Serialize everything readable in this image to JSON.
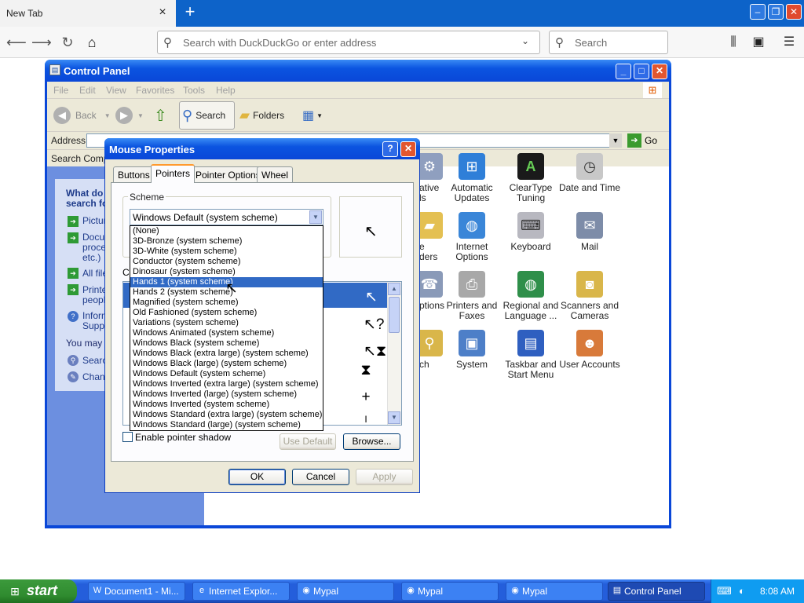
{
  "browser": {
    "tab_title": "New Tab",
    "url_placeholder": "Search with DuckDuckGo or enter address",
    "search_placeholder": "Search"
  },
  "control_panel": {
    "title": "Control Panel",
    "menu": [
      "File",
      "Edit",
      "View",
      "Favorites",
      "Tools",
      "Help"
    ],
    "toolbar": {
      "back": "Back",
      "search": "Search",
      "folders": "Folders"
    },
    "address_label": "Address",
    "go_label": "Go",
    "search_companion": "Search Compa",
    "task_header": "What do search fo",
    "tasks": [
      {
        "label": "Pictur"
      },
      {
        "label": "Docur\nproce\netc.)"
      },
      {
        "label": "All file"
      },
      {
        "label": "Printe\npeopl"
      },
      {
        "label": "Inform\nSuppo"
      }
    ],
    "may_also": "You may a",
    "extra_tasks": [
      "Search",
      "Chanc"
    ],
    "items": [
      {
        "label": "ative\nls"
      },
      {
        "label": "Automatic\nUpdates"
      },
      {
        "label": "ClearType\nTuning"
      },
      {
        "label": "Date and Time"
      },
      {
        "label": "e\nders"
      },
      {
        "label": "Internet\nOptions"
      },
      {
        "label": "Keyboard"
      },
      {
        "label": "Mail"
      },
      {
        "label": "ptions"
      },
      {
        "label": "Printers and\nFaxes"
      },
      {
        "label": "Regional and\nLanguage ..."
      },
      {
        "label": "Scanners and\nCameras"
      },
      {
        "label": "ch"
      },
      {
        "label": "System"
      },
      {
        "label": "Taskbar and\nStart Menu"
      },
      {
        "label": "User Accounts"
      }
    ]
  },
  "mouse_props": {
    "title": "Mouse Properties",
    "tabs": [
      "Buttons",
      "Pointers",
      "Pointer Options",
      "Wheel"
    ],
    "scheme_label": "Scheme",
    "scheme_value": "Windows Default (system scheme)",
    "customize_label": "C",
    "scheme_options": [
      "(None)",
      "3D-Bronze (system scheme)",
      "3D-White (system scheme)",
      "Conductor (system scheme)",
      "Dinosaur (system scheme)",
      "Hands 1 (system scheme)",
      "Hands 2 (system scheme)",
      "Magnified (system scheme)",
      "Old Fashioned (system scheme)",
      "Variations (system scheme)",
      "Windows Animated (system scheme)",
      "Windows Black  (system scheme)",
      "Windows Black (extra large) (system scheme)",
      "Windows Black (large) (system scheme)",
      "Windows Default (system scheme)",
      "Windows Inverted (extra large) (system scheme)",
      "Windows Inverted (large) (system scheme)",
      "Windows Inverted (system scheme)",
      "Windows Standard (extra large) (system scheme)",
      "Windows Standard (large) (system scheme)"
    ],
    "highlighted_option": "Hands 1 (system scheme)",
    "shadow_label": "Enable pointer shadow",
    "use_default": "Use Default",
    "browse": "Browse...",
    "ok": "OK",
    "cancel": "Cancel",
    "apply": "Apply"
  },
  "taskbar": {
    "start": "start",
    "buttons": [
      "Document1 - Mi...",
      "Internet Explor...",
      "Mypal",
      "Mypal",
      "Mypal",
      "Control Panel"
    ],
    "clock": "8:08 AM"
  }
}
